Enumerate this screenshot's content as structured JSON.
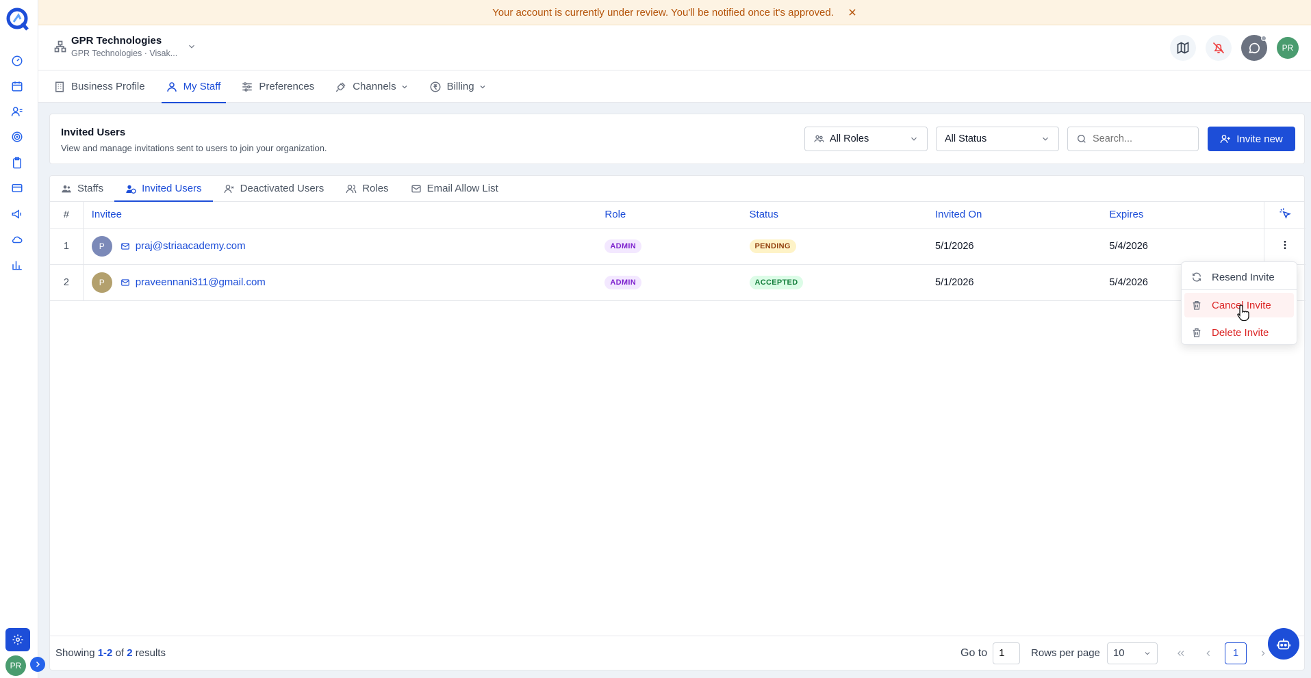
{
  "banner": {
    "message": "Your account is currently under review. You'll be notified once it's approved."
  },
  "header": {
    "org_name": "GPR Technologies",
    "org_sub": "GPR Technologies · Visak...",
    "avatar_initials": "PR"
  },
  "nav": {
    "tabs": [
      {
        "label": "Business Profile",
        "icon": "building-icon"
      },
      {
        "label": "My Staff",
        "icon": "user-icon",
        "active": true
      },
      {
        "label": "Preferences",
        "icon": "sliders-icon"
      },
      {
        "label": "Channels",
        "icon": "plug-icon",
        "dropdown": true
      },
      {
        "label": "Billing",
        "icon": "rupee-icon",
        "dropdown": true
      }
    ]
  },
  "section": {
    "title": "Invited Users",
    "description": "View and manage invitations sent to users to join your organization.",
    "roles_filter": "All Roles",
    "status_filter": "All Status",
    "search_placeholder": "Search...",
    "invite_button": "Invite new"
  },
  "subtabs": [
    {
      "label": "Staffs"
    },
    {
      "label": "Invited Users",
      "active": true
    },
    {
      "label": "Deactivated Users"
    },
    {
      "label": "Roles"
    },
    {
      "label": "Email Allow List"
    }
  ],
  "table": {
    "columns": [
      "#",
      "Invitee",
      "Role",
      "Status",
      "Invited On",
      "Expires"
    ],
    "rows": [
      {
        "num": "1",
        "initial": "P",
        "email": "praj@striaacademy.com",
        "role": "ADMIN",
        "status": "PENDING",
        "invited_on": "5/1/2026",
        "expires": "5/4/2026"
      },
      {
        "num": "2",
        "initial": "P",
        "email": "praveennani311@gmail.com",
        "role": "ADMIN",
        "status": "ACCEPTED",
        "invited_on": "5/1/2026",
        "expires": "5/4/2026"
      }
    ]
  },
  "menu": {
    "resend": "Resend Invite",
    "cancel": "Cancel Invite",
    "delete": "Delete Invite"
  },
  "footer": {
    "showing_prefix": "Showing ",
    "showing_range": "1-2",
    "showing_mid": " of ",
    "showing_total": "2",
    "showing_suffix": " results",
    "goto_label": "Go to",
    "goto_value": "1",
    "rows_per_page_label": "Rows per page",
    "rows_per_page_value": "10",
    "current_page": "1"
  },
  "sidebar": {
    "avatar_initials": "PR",
    "icons": [
      "dashboard-icon",
      "calendar-icon",
      "contacts-icon",
      "target-icon",
      "clipboard-icon",
      "card-icon",
      "megaphone-icon",
      "cloud-icon",
      "chart-icon"
    ]
  },
  "colors": {
    "accent": "#1d4ed8",
    "danger": "#dc2626",
    "banner_text": "#b45309"
  }
}
